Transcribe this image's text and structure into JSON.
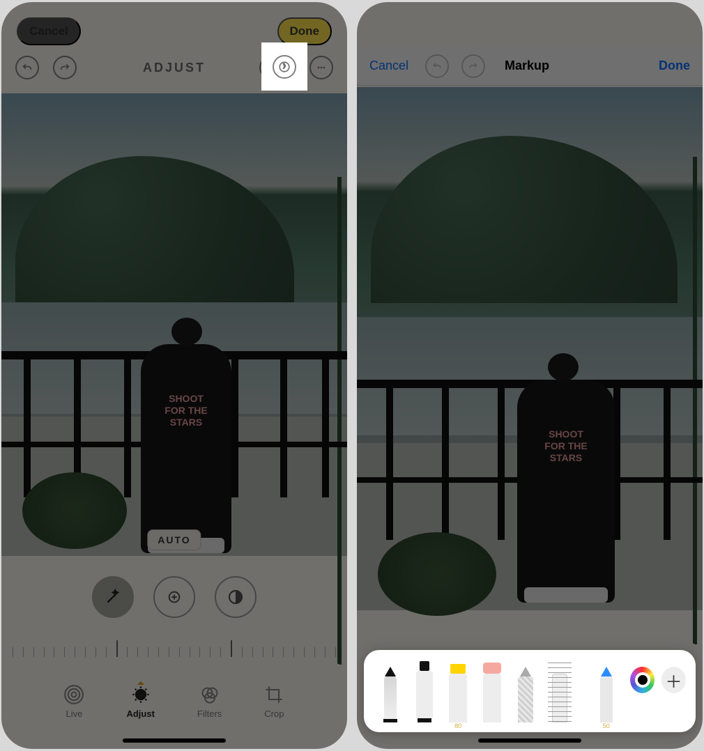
{
  "left": {
    "cancel": "Cancel",
    "done": "Done",
    "title": "ADJUST",
    "auto_chip": "AUTO",
    "adjust_buttons": [
      "magic-wand",
      "exposure",
      "contrast"
    ],
    "tabs": {
      "live": "Live",
      "adjust": "Adjust",
      "filters": "Filters",
      "crop": "Crop"
    },
    "shirt_lines": [
      "SHOOT",
      "FOR THE",
      "STARS"
    ]
  },
  "right": {
    "cancel": "Cancel",
    "title": "Markup",
    "done": "Done",
    "tools": {
      "highlighter_label": "80",
      "pencil_label": "50"
    }
  },
  "colors": {
    "ios_blue": "#0a6fff",
    "done_yellow": "#ffe24f"
  }
}
